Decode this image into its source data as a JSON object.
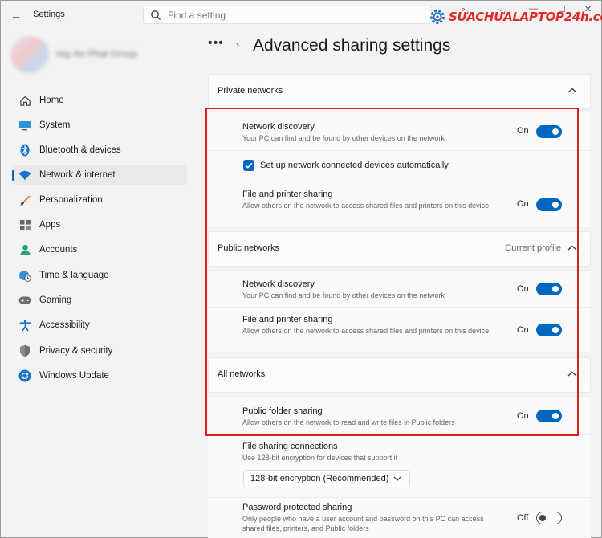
{
  "window": {
    "title": "Settings",
    "back_glyph": "←",
    "min_glyph": "—",
    "max_glyph": "☐",
    "close_glyph": "✕"
  },
  "search": {
    "placeholder": "Find a setting"
  },
  "watermark": {
    "brand": "SỬACHỮALAPTOP24h.com"
  },
  "profile": {
    "name": "Vay An Phat Group"
  },
  "sidebar": {
    "items": [
      {
        "label": "Home",
        "icon": "home-icon",
        "active": false
      },
      {
        "label": "System",
        "icon": "monitor-icon",
        "active": false
      },
      {
        "label": "Bluetooth & devices",
        "icon": "bluetooth-icon",
        "active": false
      },
      {
        "label": "Network & internet",
        "icon": "wifi-icon",
        "active": true
      },
      {
        "label": "Personalization",
        "icon": "brush-icon",
        "active": false
      },
      {
        "label": "Apps",
        "icon": "apps-icon",
        "active": false
      },
      {
        "label": "Accounts",
        "icon": "person-icon",
        "active": false
      },
      {
        "label": "Time & language",
        "icon": "globe-clock-icon",
        "active": false
      },
      {
        "label": "Gaming",
        "icon": "gamepad-icon",
        "active": false
      },
      {
        "label": "Accessibility",
        "icon": "accessibility-icon",
        "active": false
      },
      {
        "label": "Privacy & security",
        "icon": "shield-icon",
        "active": false
      },
      {
        "label": "Windows Update",
        "icon": "update-icon",
        "active": false
      }
    ]
  },
  "breadcrumb": {
    "overflow": "•••",
    "separator": "›",
    "title": "Advanced sharing settings"
  },
  "private": {
    "title": "Private networks",
    "discovery": {
      "title": "Network discovery",
      "desc": "Your PC can find and be found by other devices on the network",
      "state": "On"
    },
    "auto_setup": {
      "label": "Set up network connected devices automatically",
      "checked": true
    },
    "file_sharing": {
      "title": "File and printer sharing",
      "desc": "Allow others on the network to access shared files and printers on this device",
      "state": "On"
    }
  },
  "public": {
    "title": "Public networks",
    "badge": "Current profile",
    "discovery": {
      "title": "Network discovery",
      "desc": "Your PC can find and be found by other devices on the network",
      "state": "On"
    },
    "file_sharing": {
      "title": "File and printer sharing",
      "desc": "Allow others on the network to access shared files and printers on this device",
      "state": "On"
    }
  },
  "all": {
    "title": "All networks",
    "public_folder": {
      "title": "Public folder sharing",
      "desc": "Allow others on the network to read and write files in Public folders",
      "state": "On"
    },
    "connections": {
      "title": "File sharing connections",
      "desc": "Use 128-bit encryption for devices that support it",
      "selected": "128-bit encryption (Recommended)"
    },
    "password": {
      "title": "Password protected sharing",
      "desc": "Only people who have a user account and password on this PC can access shared files, printers, and Public folders",
      "state": "Off"
    }
  },
  "colors": {
    "accent": "#0067c0",
    "highlight": "#e02020",
    "brand": "#e02828"
  }
}
